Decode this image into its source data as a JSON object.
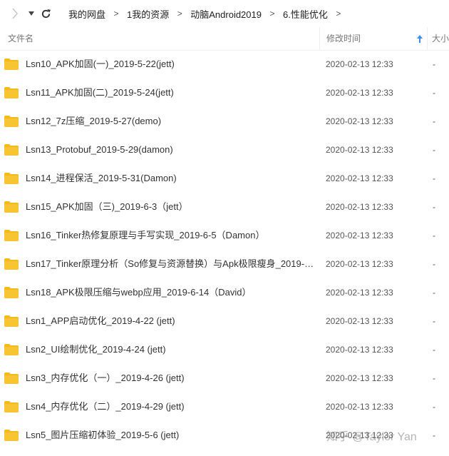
{
  "breadcrumb": [
    "我的网盘",
    "1我的资源",
    "动脑Android2019",
    "6.性能优化"
  ],
  "breadcrumb_separator": ">",
  "header": {
    "name": "文件名",
    "modified": "修改时间",
    "size": "大小"
  },
  "colors": {
    "folder": "#f7c531",
    "folder_tab": "#f1b820",
    "accent": "#3a8ff0"
  },
  "files": [
    {
      "name": "Lsn10_APK加固(一)_2019-5-22(jett)",
      "modified": "2020-02-13 12:33",
      "size": "-"
    },
    {
      "name": "Lsn11_APK加固(二)_2019-5-24(jett)",
      "modified": "2020-02-13 12:33",
      "size": "-"
    },
    {
      "name": "Lsn12_7z压缩_2019-5-27(demo)",
      "modified": "2020-02-13 12:33",
      "size": "-"
    },
    {
      "name": "Lsn13_Protobuf_2019-5-29(damon)",
      "modified": "2020-02-13 12:33",
      "size": "-"
    },
    {
      "name": "Lsn14_进程保活_2019-5-31(Damon)",
      "modified": "2020-02-13 12:33",
      "size": "-"
    },
    {
      "name": "Lsn15_APK加固（三)_2019-6-3（jett）",
      "modified": "2020-02-13 12:33",
      "size": "-"
    },
    {
      "name": "Lsn16_Tinker热修复原理与手写实现_2019-6-5（Damon）",
      "modified": "2020-02-13 12:33",
      "size": "-"
    },
    {
      "name": "Lsn17_Tinker原理分析（So修复与资源替换）与Apk极限瘦身_2019-6-12...",
      "modified": "2020-02-13 12:33",
      "size": "-"
    },
    {
      "name": "Lsn18_APK极限压缩与webp应用_2019-6-14（David）",
      "modified": "2020-02-13 12:33",
      "size": "-"
    },
    {
      "name": "Lsn1_APP启动优化_2019-4-22 (jett)",
      "modified": "2020-02-13 12:33",
      "size": "-"
    },
    {
      "name": "Lsn2_UI绘制优化_2019-4-24 (jett)",
      "modified": "2020-02-13 12:33",
      "size": "-"
    },
    {
      "name": "Lsn3_内存优化（一）_2019-4-26 (jett)",
      "modified": "2020-02-13 12:33",
      "size": "-"
    },
    {
      "name": "Lsn4_内存优化（二）_2019-4-29 (jett)",
      "modified": "2020-02-13 12:33",
      "size": "-"
    },
    {
      "name": "Lsn5_图片压缩初体验_2019-5-6 (jett)",
      "modified": "2020-02-13 12:33",
      "size": "-"
    }
  ],
  "watermark": "知乎 @Taylor Yan"
}
